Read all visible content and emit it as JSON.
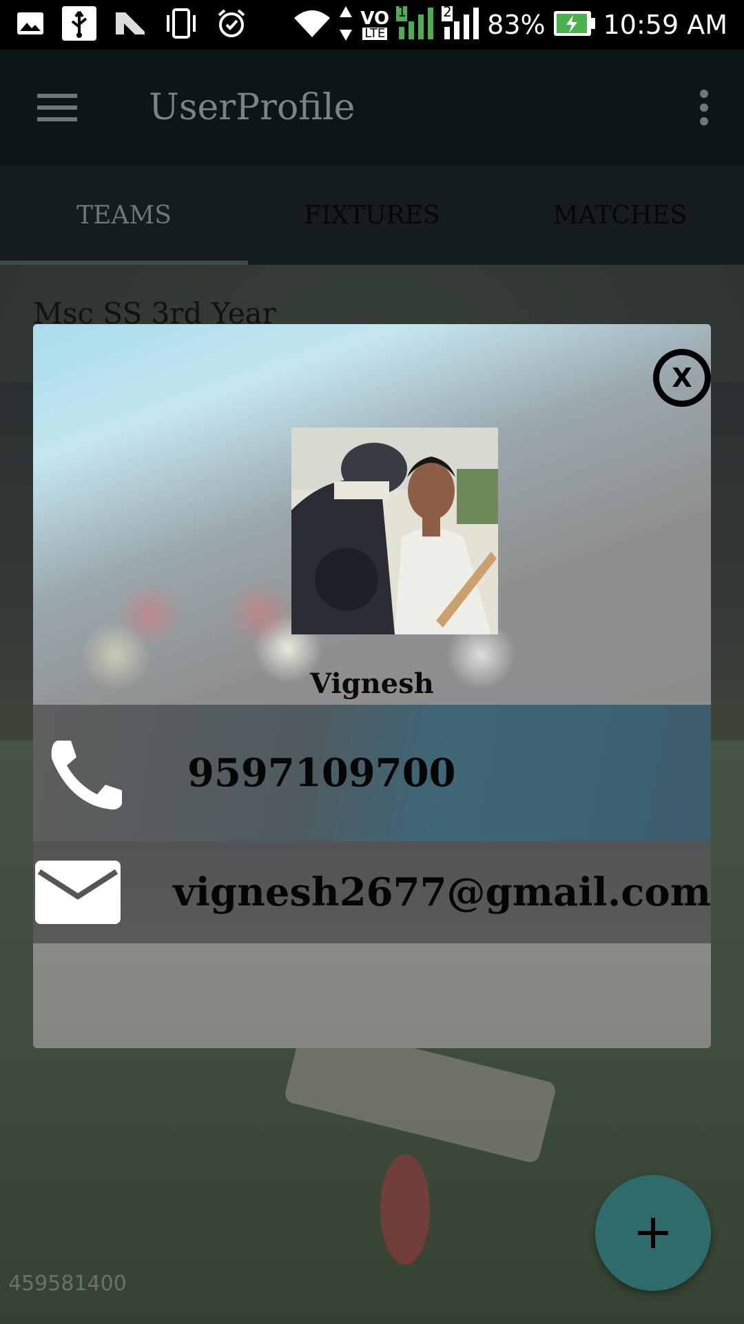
{
  "status_bar": {
    "battery": "83%",
    "time": "10:59 AM",
    "network_type": "LTE",
    "sim1": "1",
    "sim2": "2",
    "icons": [
      "gallery-icon",
      "usb-icon",
      "n-icon",
      "vibrate-icon",
      "alarm-icon",
      "wifi-icon",
      "volte-icon",
      "signal-icon",
      "battery-charging-icon"
    ]
  },
  "app_bar": {
    "title": "UserProfile",
    "menu_icon": "hamburger-menu-icon",
    "overflow_icon": "more-vert-icon"
  },
  "tabs": [
    {
      "label": "TEAMS",
      "active": true
    },
    {
      "label": "FIXTURES",
      "active": false
    },
    {
      "label": "MATCHES",
      "active": false
    }
  ],
  "background": {
    "team_title": "Msc SS 3rd Year",
    "watermark": "459581400"
  },
  "dialog": {
    "close_label": "X",
    "user_name": "Vignesh",
    "phone": "9597109700",
    "email": "vignesh2677@gmail.com",
    "avatar_icon": "profile-photo"
  },
  "fab": {
    "icon": "add-icon",
    "label": "+"
  },
  "colors": {
    "app_bar": "#0c1517",
    "tab_bar": "#151c1f",
    "fab": "#2d6c6b",
    "status_bar": "#000000"
  }
}
